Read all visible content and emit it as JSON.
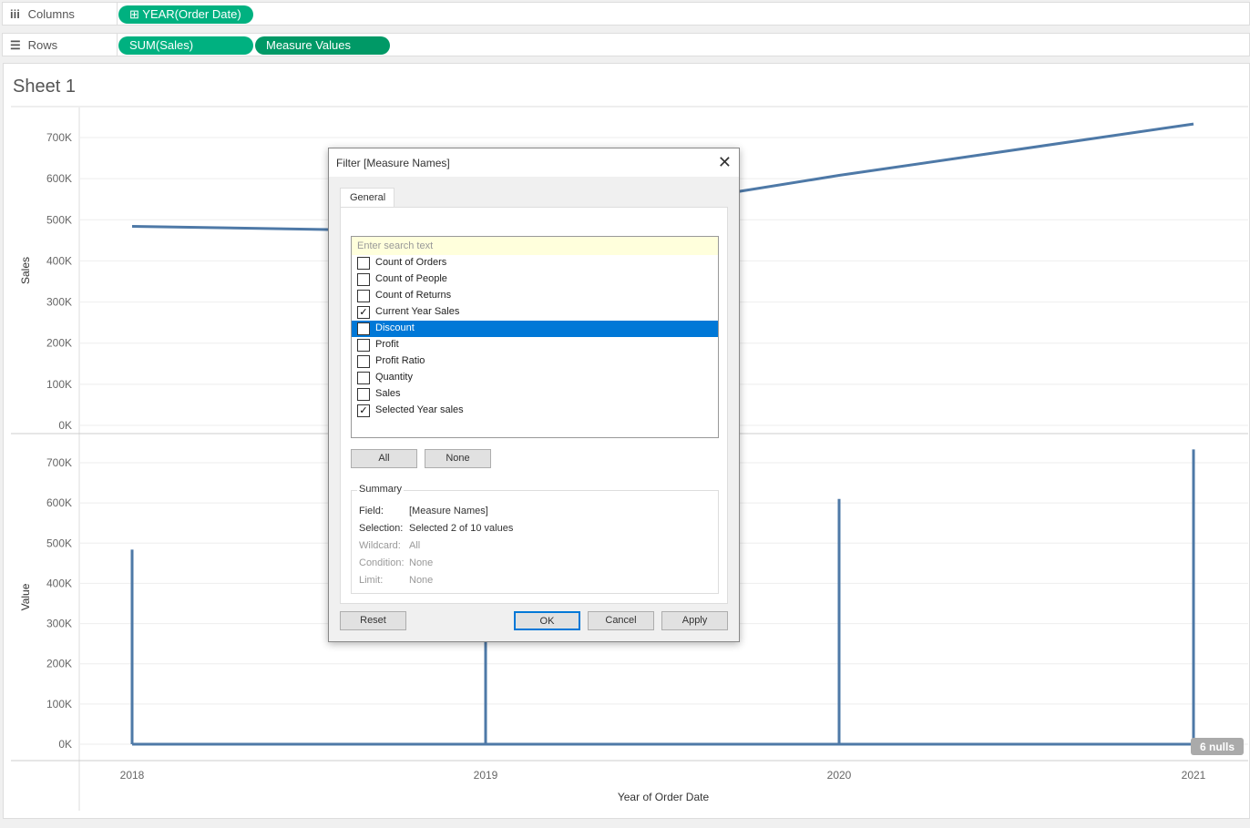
{
  "shelves": {
    "columns_label": "Columns",
    "rows_label": "Rows",
    "columns_pills": [
      "YEAR(Order Date)"
    ],
    "rows_pills": [
      "SUM(Sales)",
      "Measure Values"
    ]
  },
  "sheet_title": "Sheet 1",
  "chart_data": [
    {
      "type": "line",
      "title": "",
      "ylabel": "Sales",
      "xlabel": "Year of Order Date",
      "categories": [
        "2018",
        "2019",
        "2020",
        "2021"
      ],
      "values": [
        484000,
        470000,
        608000,
        733000
      ],
      "ylim": [
        0,
        750000
      ],
      "yticks": [
        "0K",
        "100K",
        "200K",
        "300K",
        "400K",
        "500K",
        "600K",
        "700K"
      ]
    },
    {
      "type": "line",
      "ylabel": "Value",
      "xlabel": "Year of Order Date",
      "categories": [
        "2018",
        "2019",
        "2020",
        "2021"
      ],
      "series": [
        {
          "name": "Current Year Sales",
          "values": [
            484000,
            470000,
            610000,
            733000
          ]
        },
        {
          "name": "Selected Year sales",
          "values": [
            0,
            0,
            0,
            0
          ]
        }
      ],
      "ylim": [
        0,
        750000
      ],
      "yticks": [
        "0K",
        "100K",
        "200K",
        "300K",
        "400K",
        "500K",
        "600K",
        "700K"
      ],
      "annotation": "6 nulls"
    }
  ],
  "dialog": {
    "title": "Filter [Measure Names]",
    "tab": "General",
    "search_placeholder": "Enter search text",
    "items": [
      {
        "label": "Count of Orders",
        "checked": false
      },
      {
        "label": "Count of People",
        "checked": false
      },
      {
        "label": "Count of Returns",
        "checked": false
      },
      {
        "label": "Current Year Sales",
        "checked": true
      },
      {
        "label": "Discount",
        "checked": false,
        "selected": true
      },
      {
        "label": "Profit",
        "checked": false
      },
      {
        "label": "Profit Ratio",
        "checked": false
      },
      {
        "label": "Quantity",
        "checked": false
      },
      {
        "label": "Sales",
        "checked": false
      },
      {
        "label": "Selected Year sales",
        "checked": true
      }
    ],
    "all": "All",
    "none": "None",
    "summary": {
      "title": "Summary",
      "field_k": "Field:",
      "field_v": "[Measure Names]",
      "selection_k": "Selection:",
      "selection_v": "Selected 2 of 10 values",
      "wildcard_k": "Wildcard:",
      "wildcard_v": "All",
      "condition_k": "Condition:",
      "condition_v": "None",
      "limit_k": "Limit:",
      "limit_v": "None"
    },
    "reset": "Reset",
    "ok": "OK",
    "cancel": "Cancel",
    "apply": "Apply",
    "line_color": "#4e79a7",
    "highlight": "#0078d7"
  }
}
